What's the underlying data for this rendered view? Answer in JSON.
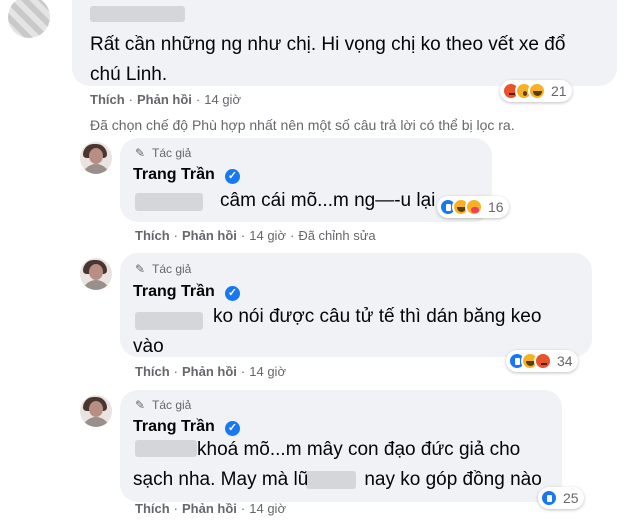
{
  "comments": [
    {
      "text_lines": [
        "Rất cần những ng như chị. Hi vọng chị ko theo vết xe đổ",
        "chú Linh."
      ],
      "actions": {
        "like": "Thích",
        "reply": "Phản hồi",
        "time": "14 giờ"
      },
      "reactions": {
        "icons": [
          "angry",
          "wow",
          "haha"
        ],
        "count": "21"
      }
    },
    {
      "author_tag": "Tác giả",
      "author": "Trang Trần",
      "text_lines": [
        "câm cái mõ...m ng—-u lại"
      ],
      "actions": {
        "like": "Thích",
        "reply": "Phản hồi",
        "time": "14 giờ",
        "edited": "Đã chỉnh sửa"
      },
      "reactions": {
        "icons": [
          "like",
          "haha",
          "care"
        ],
        "count": "16"
      }
    },
    {
      "author_tag": "Tác giả",
      "author": "Trang Trần",
      "text_lines": [
        "ko nói được câu tử tế thì dán băng keo",
        "vào"
      ],
      "actions": {
        "like": "Thích",
        "reply": "Phản hồi",
        "time": "14 giờ"
      },
      "reactions": {
        "icons": [
          "like",
          "haha",
          "angry"
        ],
        "count": "34"
      }
    },
    {
      "author_tag": "Tác giả",
      "author": "Trang Trần",
      "text_lines": [
        "khoá mõ...m mây con đạo đức giả cho",
        "sạch nha. May mà lũ",
        "nay ko góp đồng nào"
      ],
      "actions": {
        "like": "Thích",
        "reply": "Phản hồi",
        "time": "14 giờ"
      },
      "reactions": {
        "icons": [
          "like"
        ],
        "count": "25"
      }
    }
  ],
  "filter_note": "Đã chọn chế độ Phù hợp nhất nên một số câu trả lời có thể bị lọc ra.",
  "colors": {
    "bubble": "#f0f2f5",
    "muted_text": "#65676b",
    "verified": "#1877f2",
    "blur": "#d4d6d9"
  }
}
